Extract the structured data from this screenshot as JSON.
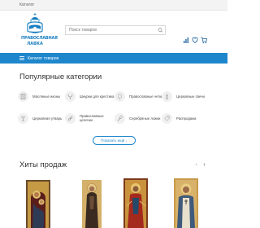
{
  "topbar": {
    "menu_link": "Каталог"
  },
  "header": {
    "logo_line1": "ПРАВОСЛАВНАЯ",
    "logo_line2": "ЛАВКА",
    "search_placeholder": "Поиск товаров",
    "icons": [
      "compare-icon",
      "favorites-icon",
      "cart-icon"
    ]
  },
  "catbar": {
    "label": "Каталог товаров",
    "icon": "burger-icon"
  },
  "popular": {
    "title": "Популярные категории",
    "items": [
      {
        "label": "Масляные иконы",
        "icon": "icon-frame"
      },
      {
        "label": "Шнурки для крестика",
        "icon": "cord-icon"
      },
      {
        "label": "Православные четки",
        "icon": "rosary-icon"
      },
      {
        "label": "Церковные свечи",
        "icon": "candle-icon"
      },
      {
        "label": "Церковная утварь",
        "icon": "utensil-icon"
      },
      {
        "label": "Православные цепочки",
        "icon": "chain-icon"
      },
      {
        "label": "Серебряные ложки",
        "icon": "spoon-icon"
      },
      {
        "label": "Распродажа",
        "icon": "sale-icon"
      }
    ],
    "more_button": "Показать ещё ↓"
  },
  "hits": {
    "title": "Хиты продаж",
    "prev": "‹",
    "next": "›",
    "products": [
      {
        "name": "product-icon-1"
      },
      {
        "name": "product-icon-2"
      },
      {
        "name": "product-icon-3"
      },
      {
        "name": "product-icon-4"
      }
    ]
  },
  "colors": {
    "accent": "#1e87cc",
    "topbar": "#f3f3f3",
    "circle": "#f0f0f0"
  }
}
